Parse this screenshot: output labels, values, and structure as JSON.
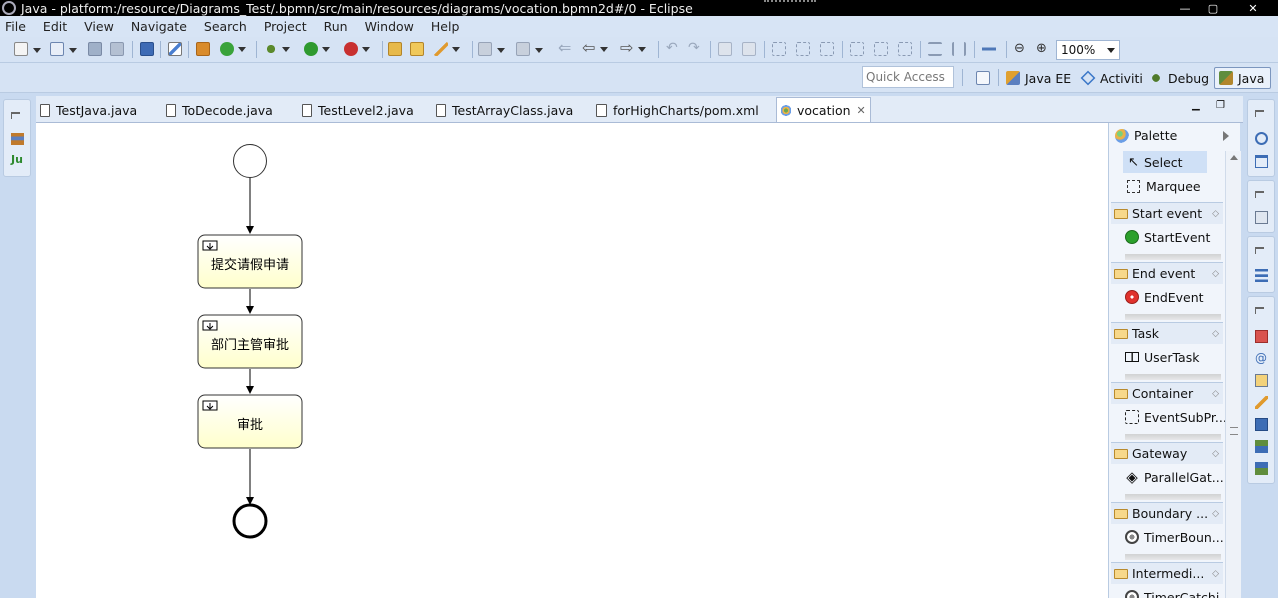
{
  "window": {
    "title": "Java - platform:/resource/Diagrams_Test/.bpmn/src/main/resources/diagrams/vocation.bpmn2d#/0 - Eclipse",
    "minimize": "—",
    "maximize": "▢",
    "close": "✕"
  },
  "menu": [
    "File",
    "Edit",
    "View",
    "Navigate",
    "Search",
    "Project",
    "Run",
    "Window",
    "Help"
  ],
  "toolbar": {
    "zoom": "100%"
  },
  "perspectives": {
    "quick_access": "Quick Access",
    "items": [
      "Java EE",
      "Activiti",
      "Debug",
      "Java"
    ]
  },
  "tabs": [
    {
      "label": "TestJava.java"
    },
    {
      "label": "ToDecode.java"
    },
    {
      "label": "TestLevel2.java"
    },
    {
      "label": "TestArrayClass.java"
    },
    {
      "label": "forHighCharts/pom.xml"
    },
    {
      "label": "vocation",
      "close": "✕"
    }
  ],
  "diagram": {
    "tasks": [
      "提交请假申请",
      "部门主管审批",
      "审批"
    ]
  },
  "palette": {
    "title": "Palette",
    "tools": [
      "Select",
      "Marquee"
    ],
    "drawers": [
      {
        "label": "Start event",
        "entry": "StartEvent"
      },
      {
        "label": "End event",
        "entry": "EndEvent"
      },
      {
        "label": "Task",
        "entry": "UserTask"
      },
      {
        "label": "Container",
        "entry": "EventSubPr..."
      },
      {
        "label": "Gateway",
        "entry": "ParallelGat..."
      },
      {
        "label": "Boundary ...",
        "entry": "TimerBoun..."
      },
      {
        "label": "Intermedi...",
        "entry": "TimerCatchi..."
      }
    ]
  },
  "colors": {
    "task_fill_top": "#ffffff",
    "task_fill_bottom": "#ffffcc",
    "start_event_green": "#2ca02c",
    "end_event_red": "#e0322d",
    "active_perspective_border": "#7c96be"
  }
}
